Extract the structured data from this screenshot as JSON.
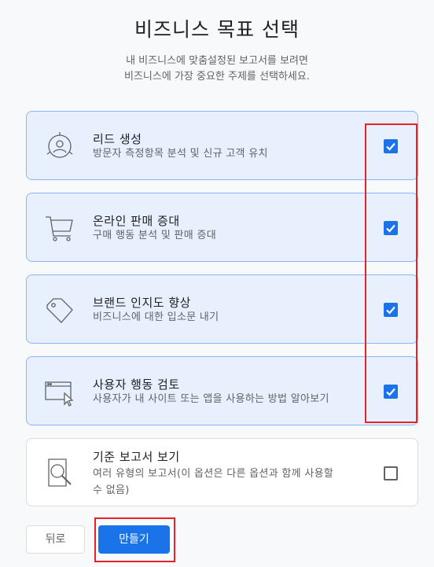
{
  "header": {
    "title": "비즈니스 목표 선택",
    "subtitle_line1": "내 비즈니스에 맞춤설정된 보고서를 보려면",
    "subtitle_line2": "비즈니스에 가장 중요한 주제를 선택하세요."
  },
  "options": [
    {
      "title": "리드 생성",
      "description": "방문자 측정항목 분석 및 신규 고객 유치",
      "checked": true,
      "icon": "lead-generation-icon"
    },
    {
      "title": "온라인 판매 증대",
      "description": "구매 행동 분석 및 판매 증대",
      "checked": true,
      "icon": "shopping-cart-icon"
    },
    {
      "title": "브랜드 인지도 향상",
      "description": "비즈니스에 대한 입소문 내기",
      "checked": true,
      "icon": "price-tag-icon"
    },
    {
      "title": "사용자 행동 검토",
      "description": "사용자가 내 사이트 또는 앱을 사용하는 방법 알아보기",
      "checked": true,
      "icon": "browser-cursor-icon"
    },
    {
      "title": "기준 보고서 보기",
      "description_line1": "여러 유형의 보고서(이 옵션은 다른 옵션과 함께 사용할",
      "description_line2": "수 없음)",
      "checked": false,
      "icon": "report-magnifier-icon"
    }
  ],
  "footer": {
    "back_label": "뒤로",
    "create_label": "만들기"
  },
  "colors": {
    "accent": "#1a73e8",
    "selected_card_bg": "#e8f0fe",
    "highlight": "#e8222a"
  }
}
